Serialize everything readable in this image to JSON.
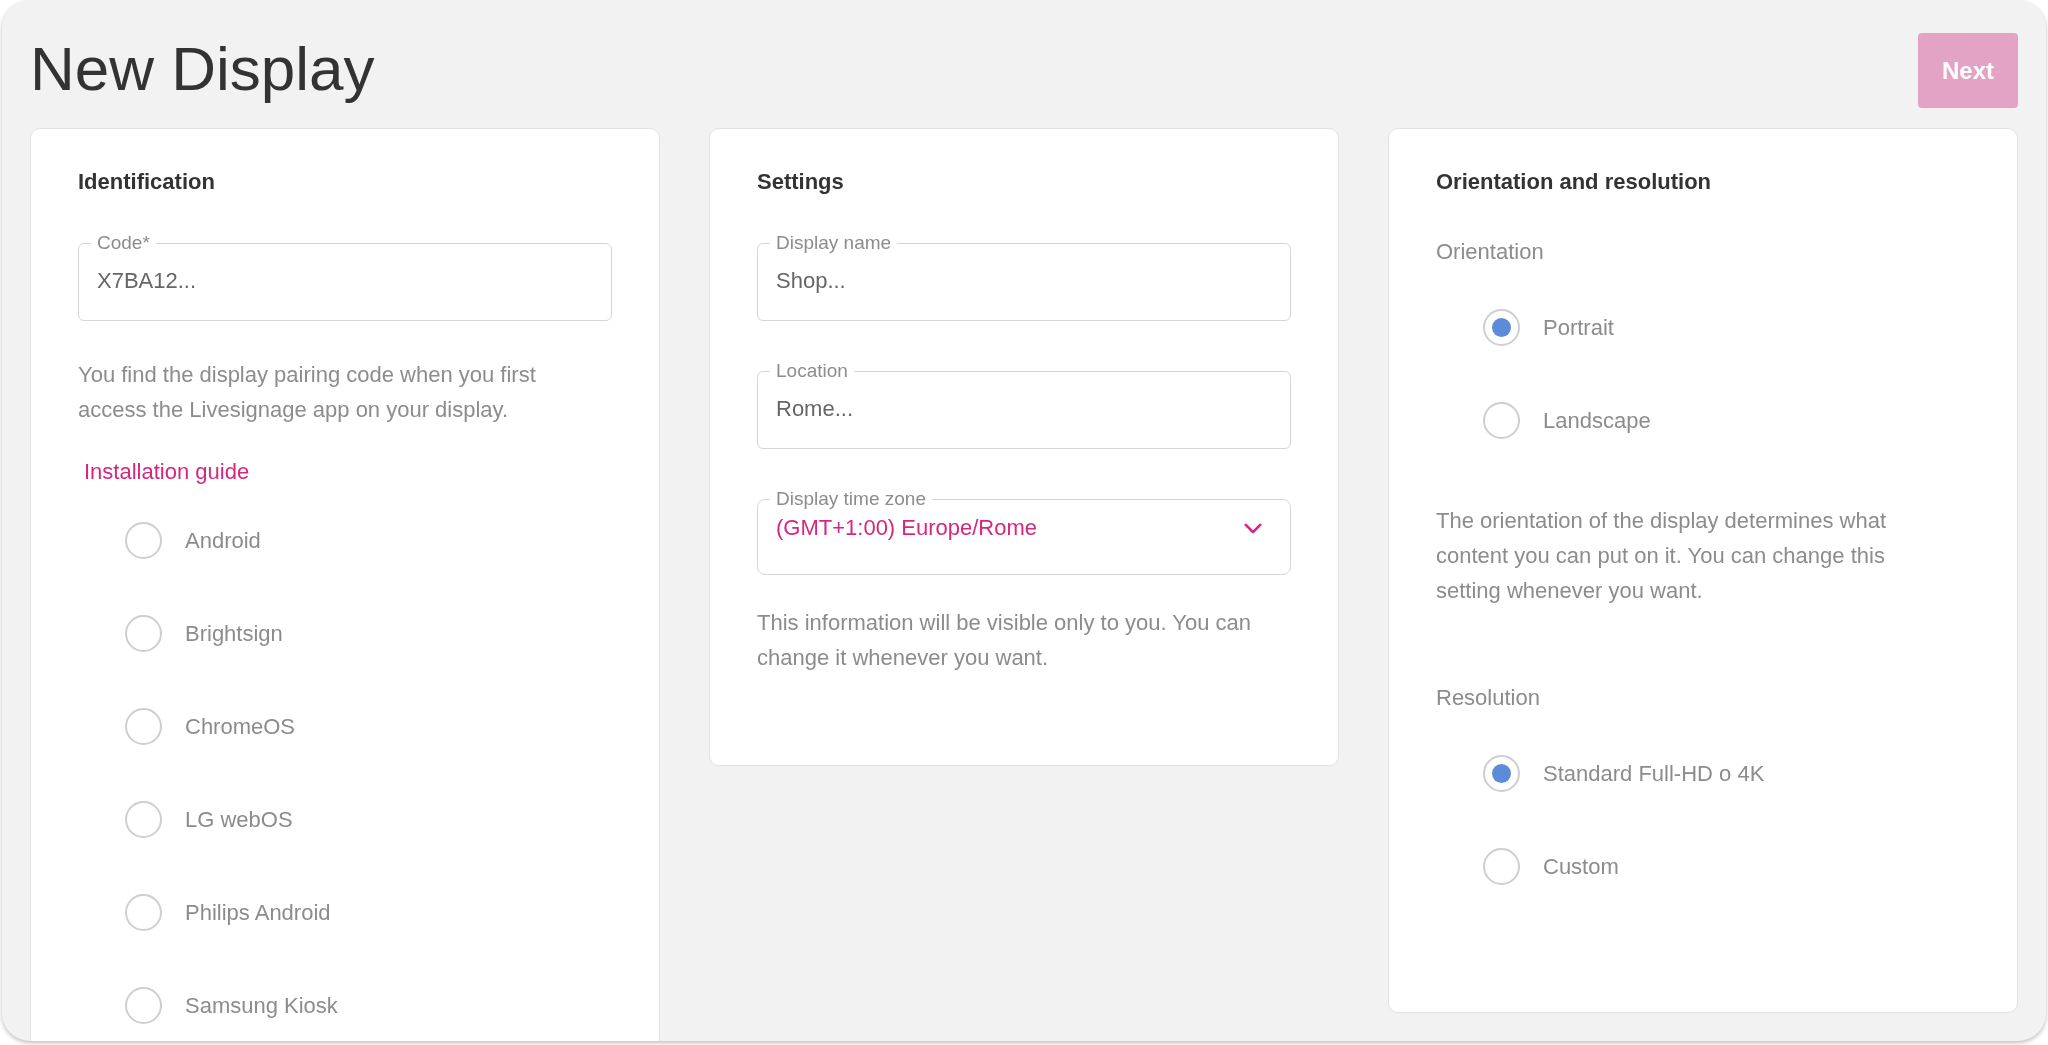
{
  "page": {
    "title": "New Display",
    "next_button": {
      "label": "Next",
      "disabled": true
    }
  },
  "identification": {
    "title": "Identification",
    "code_field": {
      "label": "Code*",
      "placeholder": "X7BA12..."
    },
    "help_text": "You find the display pairing code when you first access the Livesignage app on your display.",
    "guide_link": "Installation guide",
    "platforms": [
      {
        "label": "Android",
        "selected": false
      },
      {
        "label": "Brightsign",
        "selected": false
      },
      {
        "label": "ChromeOS",
        "selected": false
      },
      {
        "label": "LG webOS",
        "selected": false
      },
      {
        "label": "Philips Android",
        "selected": false
      },
      {
        "label": "Samsung Kiosk",
        "selected": false
      }
    ]
  },
  "settings": {
    "title": "Settings",
    "fields": [
      {
        "label": "Display name",
        "placeholder": "Shop..."
      },
      {
        "label": "Location",
        "placeholder": "Rome..."
      }
    ],
    "time_zone": {
      "label": "Display time zone",
      "value": "(GMT+1:00) Europe/Rome"
    },
    "help_text": "This information will be visible only to you. You can change it whenever you want."
  },
  "orientation_resolution": {
    "title": "Orientation and resolution",
    "orientation_label": "Orientation",
    "orientations": [
      {
        "label": "Portrait",
        "selected": true
      },
      {
        "label": "Landscape",
        "selected": false
      }
    ],
    "help_text": "The orientation of the display determines what content you can put on it. You can change this setting whenever you want.",
    "resolution_label": "Resolution",
    "resolutions": [
      {
        "label": "Standard Full-HD o 4K",
        "selected": true
      },
      {
        "label": "Custom",
        "selected": false
      }
    ]
  }
}
